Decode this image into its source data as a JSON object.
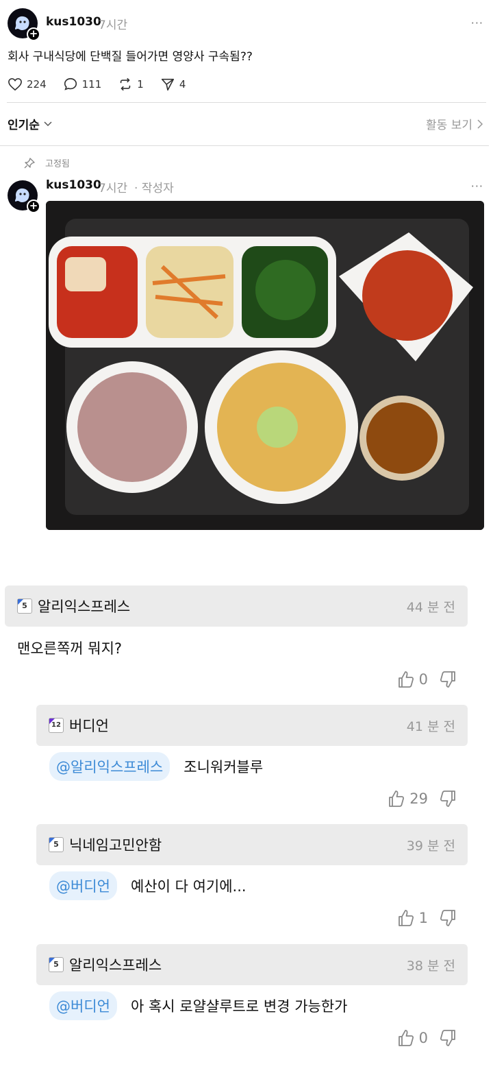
{
  "post": {
    "username": "kus1030",
    "time": "7시간",
    "more": "···",
    "text": "회사 구내식당에 단백질 들어가면 영양사 구속됨??",
    "stats": {
      "likes": "224",
      "comments": "111",
      "reposts": "1",
      "shares": "4"
    }
  },
  "sort": {
    "label": "인기순",
    "activity_label": "활동 보기"
  },
  "pinned_reply": {
    "pinned_label": "고정됨",
    "username": "kus1030",
    "time": "7시간",
    "author_tag": "· 작성자",
    "more": "···"
  },
  "comments": [
    {
      "name": "알리익스프레스",
      "time": "44 분 전",
      "badge": "5",
      "mention": "",
      "text": "맨오른쪽꺼 뭐지?",
      "likes": "0"
    },
    {
      "name": "버디언",
      "time": "41 분 전",
      "badge": "12",
      "mention": "@알리익스프레스",
      "text": "조니워커블루",
      "likes": "29"
    },
    {
      "name": "닉네임고민안함",
      "time": "39 분 전",
      "badge": "5",
      "mention": "@버디언",
      "text": "예산이 다 여기에...",
      "likes": "1"
    },
    {
      "name": "알리익스프레스",
      "time": "38 분 전",
      "badge": "5",
      "mention": "@버디언",
      "text": "아 혹시 로얄샬루트로 변경 가능한가",
      "likes": "0"
    }
  ],
  "colors": {
    "mention_bg": "#e6f1fc",
    "mention_text": "#3c8ad6",
    "comment_head_bg": "#ebebeb"
  }
}
